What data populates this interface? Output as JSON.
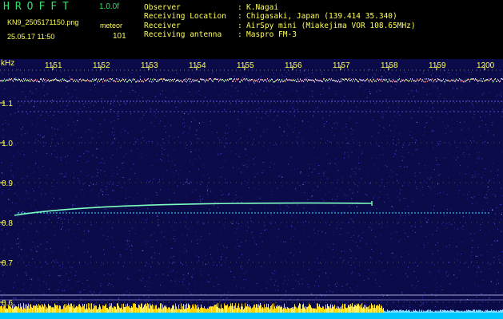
{
  "header": {
    "app_title": "HROFFT",
    "version": "1.0.0f",
    "filename": "KN9_2505171150.png",
    "mode": "meteor",
    "timestamp": "25.05.17 11:50",
    "count": "101"
  },
  "info": {
    "rows": [
      {
        "label": "Observer",
        "value": "K.Nagai"
      },
      {
        "label": "Receiving Location",
        "value": "Chigasaki, Japan (139.414 35.340)"
      },
      {
        "label": "Receiver",
        "value": "AirSpy mini (Miakejima VOR 108.65MHz)"
      },
      {
        "label": "Receiving antenna",
        "value": "Maspro FM-3"
      }
    ],
    "separator": ":"
  },
  "axis": {
    "unit": "kHz",
    "time_labels": [
      "1151",
      "1152",
      "1153",
      "1154",
      "1155",
      "1156",
      "1157",
      "1158",
      "1159",
      "1200"
    ],
    "freq_labels": [
      "1.1",
      "1.0",
      "0.9",
      "0.8",
      "0.7",
      "0.6"
    ]
  },
  "colors": {
    "background": "#000000",
    "accent_green": "#2fe06a",
    "label_yellow": "#ffff55",
    "noise_blue": "#1a1a7a",
    "signal_line": "#66ffaa",
    "baseline": "#00d8ff"
  }
}
